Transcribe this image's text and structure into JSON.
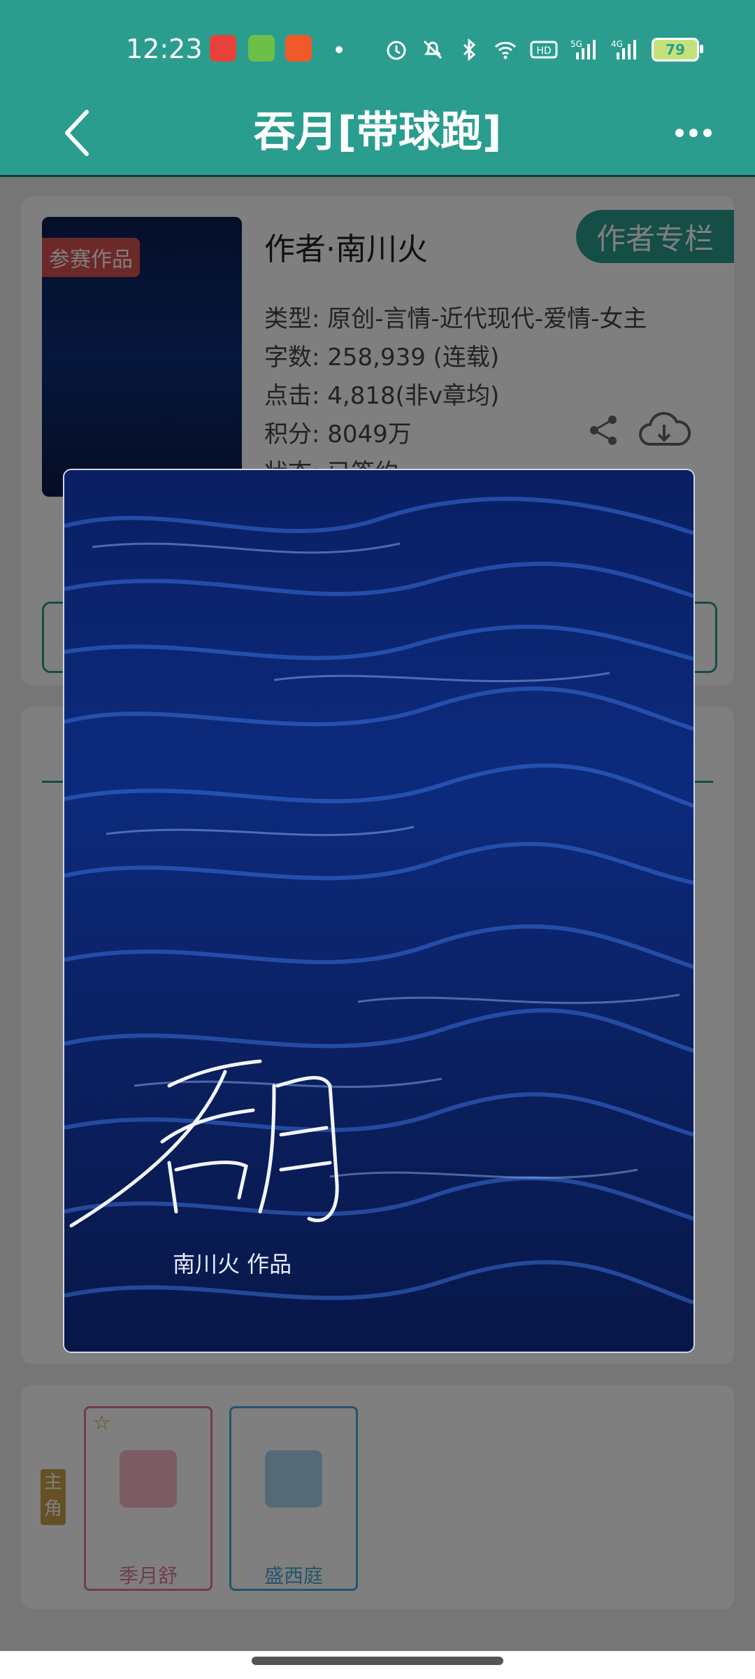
{
  "status": {
    "time": "12:23",
    "battery": "79",
    "icons": [
      "alarm-icon",
      "mute-icon",
      "bluetooth-icon",
      "wifi-icon",
      "hd-icon",
      "signal-5g-icon",
      "signal-4g-icon"
    ]
  },
  "nav": {
    "title": "吞月[带球跑]",
    "back_icon": "back-chevron-icon",
    "more_icon": "more-dots-icon"
  },
  "book": {
    "contest_tag": "参赛作品",
    "author": "作者·南川火",
    "author_column_button": "作者专栏",
    "type": "类型: 原创-言情-近代现代-爱情-女主",
    "word_count": "字数: 258,939 (连载)",
    "clicks": "点击: 4,818(非v章均)",
    "score": "积分: 8049万",
    "status_partial": "状态: 已签约"
  },
  "cast": {
    "role_tag": "主角",
    "characters": [
      {
        "name": "季月舒",
        "color": "#e07a94"
      },
      {
        "name": "盛西庭",
        "color": "#4aa8d8"
      }
    ]
  },
  "cover": {
    "author_credit": "南川火 作品"
  },
  "colors": {
    "brand": "#2a9d8f",
    "cover_blue": "#0a1a55"
  }
}
